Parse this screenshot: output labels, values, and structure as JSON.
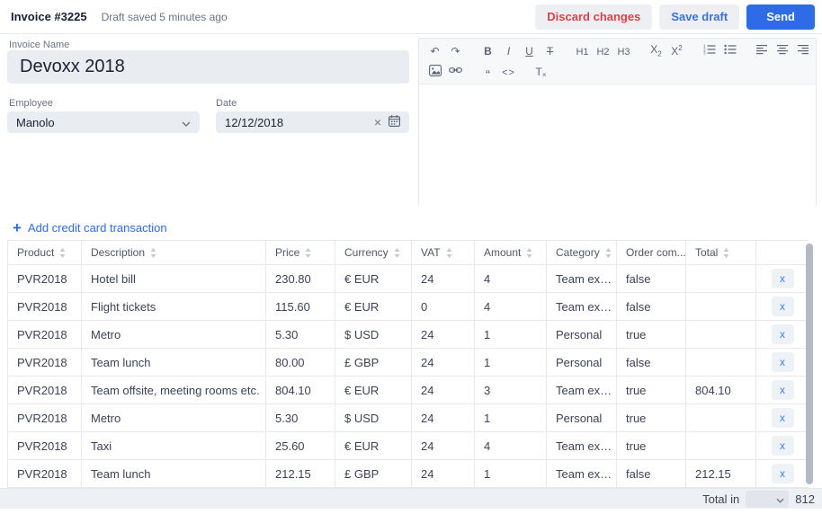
{
  "colors": {
    "accent_blue": "#2e6be6",
    "danger_red": "#df4044",
    "link_blue": "#2e6be6",
    "input_bg": "#e9edf2",
    "border": "#e3e8ee"
  },
  "header": {
    "title": "Invoice #3225",
    "status": "Draft saved 5 minutes ago",
    "buttons": {
      "discard": "Discard changes",
      "save_draft": "Save draft",
      "send": "Send"
    }
  },
  "form": {
    "invoice_name_label": "Invoice Name",
    "invoice_name_value": "Devoxx 2018",
    "employee_label": "Employee",
    "employee_value": "Manolo",
    "date_label": "Date",
    "date_value": "12/12/2018"
  },
  "editor": {
    "toolbar_groups_row1": [
      [
        "undo",
        "redo"
      ],
      [
        "bold",
        "italic",
        "underline",
        "strikethrough"
      ],
      [
        "h1",
        "h2",
        "h3"
      ],
      [
        "subscript",
        "superscript"
      ],
      [
        "ordered-list",
        "bullet-list"
      ],
      [
        "align-left",
        "align-center",
        "align-right"
      ]
    ],
    "toolbar_groups_row2": [
      [
        "image",
        "link"
      ],
      [
        "blockquote",
        "code"
      ],
      [
        "clear-format"
      ]
    ],
    "content": ""
  },
  "transactions": {
    "add_link": "Add credit card transaction",
    "columns": [
      "Product",
      "Description",
      "Price",
      "Currency",
      "VAT",
      "Amount",
      "Category",
      "Order com...",
      "Total"
    ],
    "delete_button": "x",
    "rows": [
      {
        "product": "PVR2018",
        "description": "Hotel bill",
        "price": "230.80",
        "currency": "€ EUR",
        "vat": "24",
        "amount": "4",
        "category": "Team expe...",
        "order_completed": "false",
        "total": ""
      },
      {
        "product": "PVR2018",
        "description": "Flight tickets",
        "price": "115.60",
        "currency": "€ EUR",
        "vat": "0",
        "amount": "4",
        "category": "Team expe...",
        "order_completed": "false",
        "total": ""
      },
      {
        "product": "PVR2018",
        "description": "Metro",
        "price": "5.30",
        "currency": "$ USD",
        "vat": "24",
        "amount": "1",
        "category": "Personal",
        "order_completed": "true",
        "total": ""
      },
      {
        "product": "PVR2018",
        "description": "Team lunch",
        "price": "80.00",
        "currency": "£ GBP",
        "vat": "24",
        "amount": "1",
        "category": "Personal",
        "order_completed": "false",
        "total": ""
      },
      {
        "product": "PVR2018",
        "description": "Team offsite, meeting rooms etc.",
        "price": "804.10",
        "currency": "€ EUR",
        "vat": "24",
        "amount": "3",
        "category": "Team expe...",
        "order_completed": "true",
        "total": "804.10"
      },
      {
        "product": "PVR2018",
        "description": "Metro",
        "price": "5.30",
        "currency": "$ USD",
        "vat": "24",
        "amount": "1",
        "category": "Personal",
        "order_completed": "true",
        "total": ""
      },
      {
        "product": "PVR2018",
        "description": "Taxi",
        "price": "25.60",
        "currency": "€ EUR",
        "vat": "24",
        "amount": "4",
        "category": "Team expe...",
        "order_completed": "true",
        "total": ""
      },
      {
        "product": "PVR2018",
        "description": "Team lunch",
        "price": "212.15",
        "currency": "£ GBP",
        "vat": "24",
        "amount": "1",
        "category": "Team expe...",
        "order_completed": "false",
        "total": "212.15"
      }
    ]
  },
  "footer": {
    "label": "Total in",
    "currency_selected": "",
    "total": "812"
  }
}
